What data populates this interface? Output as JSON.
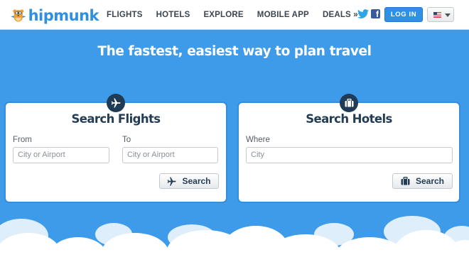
{
  "header": {
    "logo_text": "hipmunk",
    "nav": [
      {
        "label": "FLIGHTS"
      },
      {
        "label": "HOTELS"
      },
      {
        "label": "EXPLORE"
      },
      {
        "label": "MOBILE APP"
      },
      {
        "label": "DEALS »"
      }
    ],
    "twitter_icon": "twitter-bird",
    "facebook_icon": "facebook-f",
    "facebook_glyph": "f",
    "login_label": "LOG IN",
    "locale_flag": "us-flag"
  },
  "hero": {
    "tagline": "The fastest, easiest way to plan travel",
    "background_color": "#3d9be9"
  },
  "flights_card": {
    "icon": "airplane",
    "title": "Search Flights",
    "from_label": "From",
    "from_placeholder": "City or Airport",
    "to_label": "To",
    "to_placeholder": "City or Airport",
    "search_label": "Search"
  },
  "hotels_card": {
    "icon": "suitcase",
    "title": "Search Hotels",
    "where_label": "Where",
    "where_placeholder": "City",
    "search_label": "Search"
  },
  "colors": {
    "brand_blue": "#2f8fe0",
    "card_title": "#233d55",
    "badge": "#1f3b55"
  }
}
